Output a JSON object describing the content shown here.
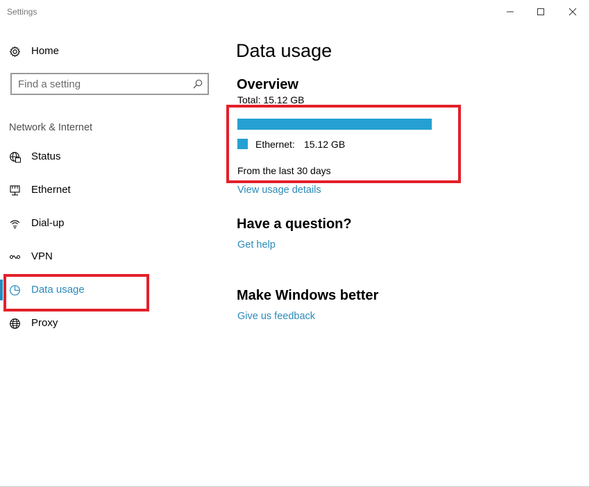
{
  "window": {
    "title": "Settings"
  },
  "sidebar": {
    "home_label": "Home",
    "search": {
      "placeholder": "Find a setting",
      "value": ""
    },
    "group_heading": "Network & Internet",
    "items": [
      {
        "label": "Status",
        "icon": "globe-status-icon"
      },
      {
        "label": "Ethernet",
        "icon": "ethernet-icon"
      },
      {
        "label": "Dial-up",
        "icon": "dialup-icon"
      },
      {
        "label": "VPN",
        "icon": "vpn-icon"
      },
      {
        "label": "Data usage",
        "icon": "pie-chart-icon",
        "selected": true
      },
      {
        "label": "Proxy",
        "icon": "globe-icon"
      }
    ],
    "highlight_target": "Data usage"
  },
  "main": {
    "page_title": "Data usage",
    "overview": {
      "heading": "Overview",
      "total": "Total: 15.12 GB",
      "ethernet_share": 1.0,
      "legend_label": "Ethernet:",
      "legend_value": "15.12 GB",
      "period": "From the last 30 days",
      "details_link": "View usage details"
    },
    "question": {
      "heading": "Have a question?",
      "link": "Get help"
    },
    "feedback": {
      "heading": "Make Windows better",
      "link": "Give us feedback"
    }
  },
  "colors": {
    "accent": "#2a8ab9",
    "bar": "#26a0d2",
    "highlight": "#e3202a"
  }
}
